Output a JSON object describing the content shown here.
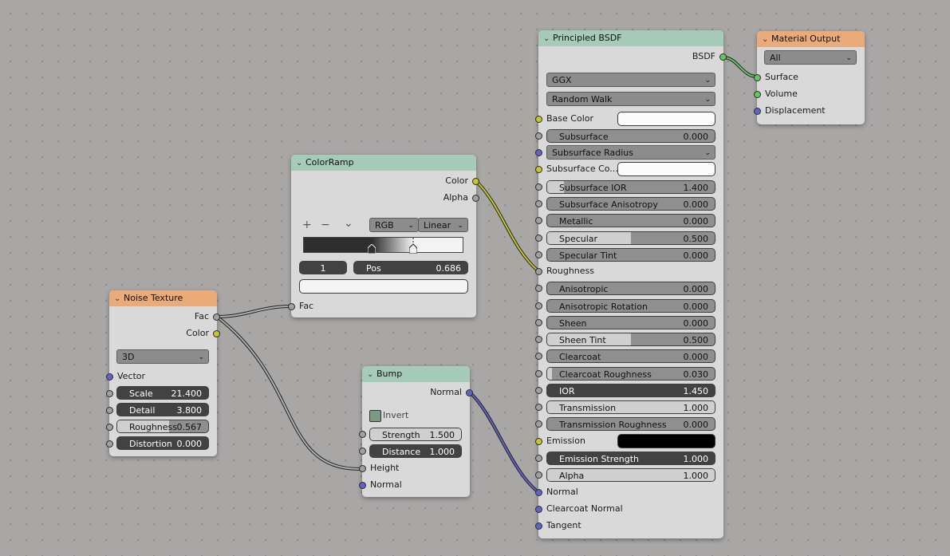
{
  "noise_texture": {
    "title": "Noise Texture",
    "outputs": [
      "Fac",
      "Color"
    ],
    "dimension": "3D",
    "vector_label": "Vector",
    "fields": [
      {
        "label": "Scale",
        "value": "21.400"
      },
      {
        "label": "Detail",
        "value": "3.800"
      },
      {
        "label": "Roughness",
        "value": "0.567",
        "fill": 0.567
      },
      {
        "label": "Distortion",
        "value": "0.000"
      }
    ]
  },
  "color_ramp": {
    "title": "ColorRamp",
    "outputs": [
      "Color",
      "Alpha"
    ],
    "tools": [
      "+",
      "−",
      "⌄"
    ],
    "color_mode": "RGB",
    "interpolation": "Linear",
    "active_index": "1",
    "pos_label": "Pos",
    "pos_value": "0.686",
    "input_fac": "Fac"
  },
  "bump": {
    "title": "Bump",
    "output": "Normal",
    "invert_label": "Invert",
    "fields": [
      {
        "label": "Strength",
        "value": "1.500",
        "fill": 1.0
      },
      {
        "label": "Distance",
        "value": "1.000"
      }
    ],
    "inputs": [
      "Height",
      "Normal"
    ]
  },
  "principled": {
    "title": "Principled BSDF",
    "output": "BSDF",
    "distribution": "GGX",
    "subsurface_method": "Random Walk",
    "base_color_label": "Base Color",
    "subsurface_label": "Subsurface",
    "subsurface_value": "0.000",
    "subsurface_radius": "Subsurface Radius",
    "subsurface_color_label": "Subsurface Co...",
    "fields": [
      {
        "label": "Subsurface IOR",
        "value": "1.400",
        "fill": 0.1
      },
      {
        "label": "Subsurface Anisotropy",
        "value": "0.000"
      },
      {
        "label": "Metallic",
        "value": "0.000"
      },
      {
        "label": "Specular",
        "value": "0.500",
        "fill": 0.5
      },
      {
        "label": "Specular Tint",
        "value": "0.000"
      }
    ],
    "roughness_label": "Roughness",
    "fields2": [
      {
        "label": "Anisotropic",
        "value": "0.000"
      },
      {
        "label": "Anisotropic Rotation",
        "value": "0.000"
      },
      {
        "label": "Sheen",
        "value": "0.000"
      },
      {
        "label": "Sheen Tint",
        "value": "0.500",
        "fill": 0.5
      },
      {
        "label": "Clearcoat",
        "value": "0.000"
      },
      {
        "label": "Clearcoat Roughness",
        "value": "0.030",
        "fill": 0.03
      },
      {
        "label": "IOR",
        "value": "1.450"
      },
      {
        "label": "Transmission",
        "value": "1.000",
        "fill": 1.0
      },
      {
        "label": "Transmission Roughness",
        "value": "0.000"
      }
    ],
    "emission_label": "Emission",
    "emission_color": "#000000",
    "fields3": [
      {
        "label": "Emission Strength",
        "value": "1.000"
      },
      {
        "label": "Alpha",
        "value": "1.000",
        "fill": 1.0
      }
    ],
    "inputs_tail": [
      "Normal",
      "Clearcoat Normal",
      "Tangent"
    ]
  },
  "material_output": {
    "title": "Material Output",
    "target": "All",
    "inputs": [
      "Surface",
      "Volume",
      "Displacement"
    ]
  },
  "colors": {
    "node_header_shader": "#a6cbb8",
    "node_header_texture": "#e9ab7a",
    "socket_float": "#a1a1a1",
    "socket_color": "#c7c729",
    "socket_vector": "#6363c7",
    "socket_shader": "#63c763"
  }
}
